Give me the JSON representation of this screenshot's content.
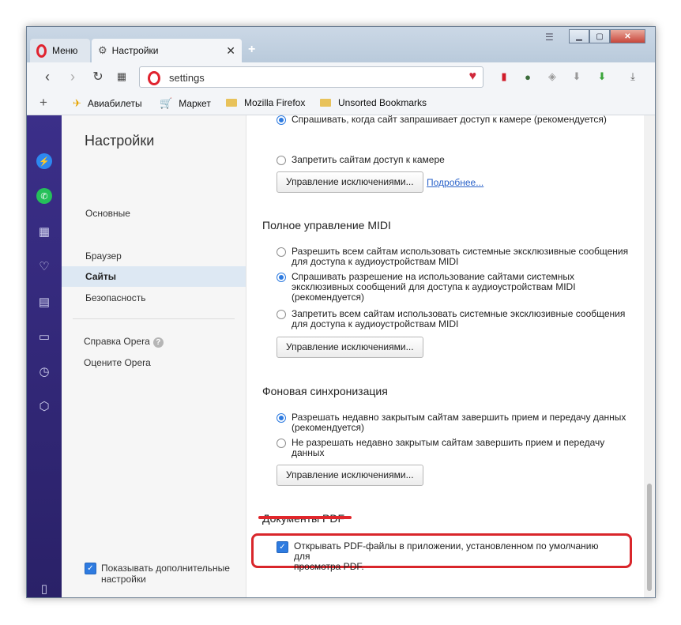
{
  "tabs": [
    {
      "label": "Меню",
      "icon": "opera-logo-icon"
    },
    {
      "label": "Настройки",
      "icon": "gear-icon"
    }
  ],
  "address": {
    "value": "settings"
  },
  "bookmarks": [
    {
      "label": "Авиабилеты",
      "icon": "plane-icon"
    },
    {
      "label": "Маркет",
      "icon": "cart-icon"
    },
    {
      "label": "Mozilla Firefox",
      "icon": "folder-icon"
    },
    {
      "label": "Unsorted Bookmarks",
      "icon": "folder-icon"
    }
  ],
  "leftpanel": {
    "title": "Настройки",
    "items": [
      "Основные",
      "Браузер",
      "Сайты",
      "Безопасность"
    ],
    "help": "Справка Opera",
    "rate": "Оцените Opera",
    "show_advanced": "Показывать дополнительные настройки"
  },
  "camera": {
    "opt_ask": "Спрашивать, когда сайт запрашивает доступ к камере (рекомендуется)",
    "opt_deny": "Запретить сайтам доступ к камере",
    "manage": "Управление исключениями...",
    "more": "Подробнее..."
  },
  "midi": {
    "title": "Полное управление MIDI",
    "opt1_l1": "Разрешить всем сайтам использовать системные эксклюзивные сообщения",
    "opt1_l2": "для доступа к аудиоустройствам MIDI",
    "opt2_l1": "Спрашивать разрешение на использование сайтами системных",
    "opt2_l2": "эксклюзивных сообщений для доступа к аудиоустройствам MIDI",
    "opt2_l3": "(рекомендуется)",
    "opt3_l1": "Запретить всем сайтам использовать системные эксклюзивные сообщения",
    "opt3_l2": "для доступа к аудиоустройствам MIDI",
    "manage": "Управление исключениями..."
  },
  "sync": {
    "title": "Фоновая синхронизация",
    "opt1_l1": "Разрешать недавно закрытым сайтам завершить прием и передачу данных",
    "opt1_l2": "(рекомендуется)",
    "opt2_l1": "Не разрешать недавно закрытым сайтам завершить прием и передачу",
    "opt2_l2": "данных",
    "manage": "Управление исключениями..."
  },
  "pdf": {
    "title": "Документы PDF",
    "opt_l1": "Открывать PDF-файлы в приложении, установленном по умолчанию для",
    "opt_l2": "просмотра PDF."
  },
  "colors": {
    "accent": "#2e7be0",
    "highlight": "#d9262b",
    "sidebar": "#3b2f89",
    "opera": "#e0232f"
  }
}
